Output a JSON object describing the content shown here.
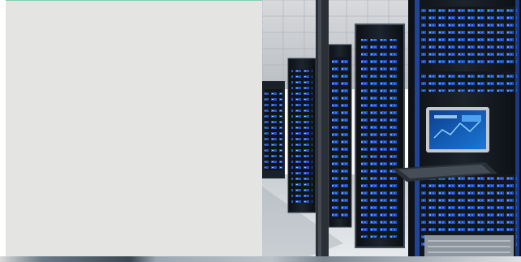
{
  "slide": {
    "text_panel": "",
    "photo_icon": "server-racks-datacenter-photo"
  },
  "colors": {
    "panel": "#e4e4e2",
    "accent_line": "#7fcfb0",
    "led_blue": "#2f6bff",
    "rack_dark": "#151a20"
  }
}
